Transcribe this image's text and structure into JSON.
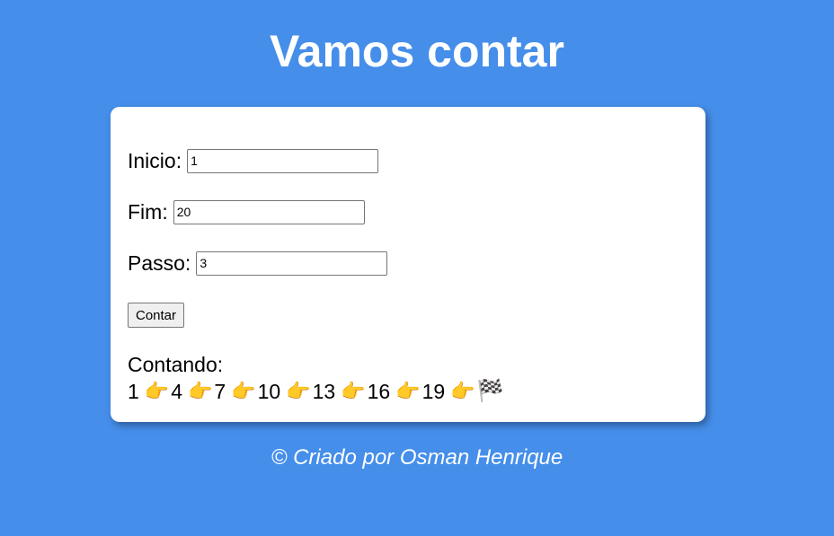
{
  "header": {
    "title": "Vamos contar"
  },
  "form": {
    "inicio": {
      "label": "Inicio:",
      "value": "1"
    },
    "fim": {
      "label": "Fim:",
      "value": "20"
    },
    "passo": {
      "label": "Passo:",
      "value": "3"
    },
    "button_label": "Contar"
  },
  "result": {
    "heading": "Contando:",
    "values": [
      "1",
      "4",
      "7",
      "10",
      "13",
      "16",
      "19"
    ],
    "arrow": "👉",
    "end": "🏁"
  },
  "footer": {
    "text": "© Criado por Osman Henrique"
  },
  "colors": {
    "background": "#458eea",
    "card": "#ffffff",
    "text": "#000000"
  }
}
